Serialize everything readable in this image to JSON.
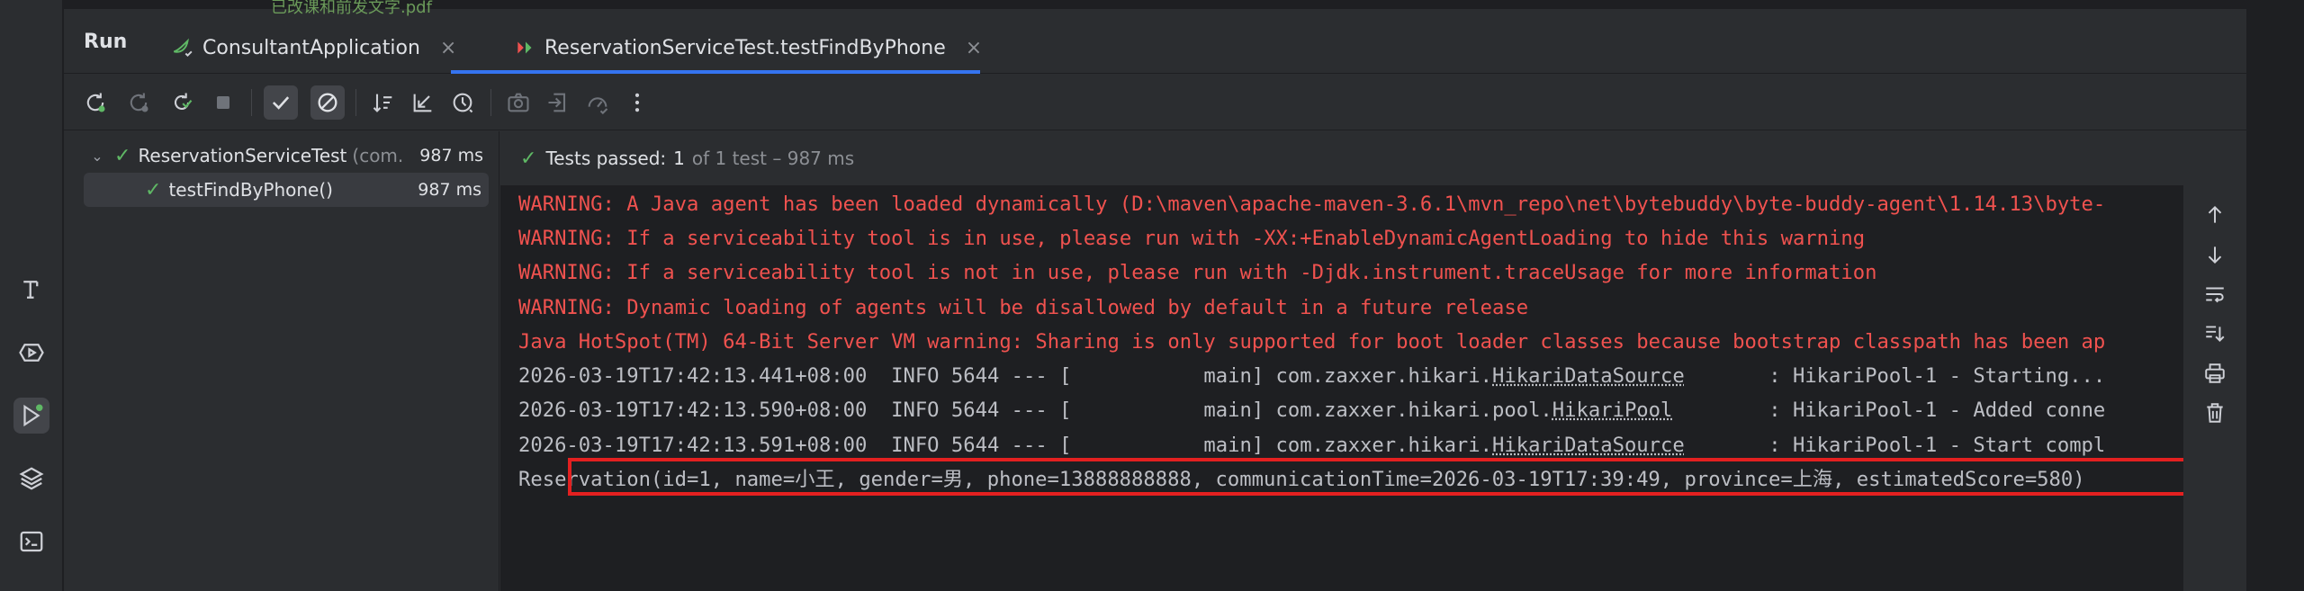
{
  "top_fragment": "已改课和前发文字.pdf",
  "tool_window": {
    "title": "Run"
  },
  "tabs": [
    {
      "label": "ConsultantApplication",
      "icon": "spring-app-icon",
      "close": "×"
    },
    {
      "label": "ReservationServiceTest.testFindByPhone",
      "icon": "test-run-icon",
      "close": "×"
    }
  ],
  "toolbar": {
    "buttons": [
      "rerun-icon",
      "rerun-failed-icon",
      "rerun-auto-icon",
      "stop-icon",
      "show-passed-icon",
      "show-ignored-icon",
      "sort-icon",
      "collapse-icon",
      "history-icon",
      "screenshot-icon",
      "export-icon",
      "coverage-icon",
      "more-icon"
    ]
  },
  "tree": {
    "root": {
      "label": "ReservationServiceTest",
      "package": "(com.",
      "duration": "987 ms"
    },
    "child": {
      "label": "testFindByPhone()",
      "duration": "987 ms"
    }
  },
  "status": {
    "prefix": "Tests passed:",
    "count": "1",
    "suffix": "of 1 test – 987 ms"
  },
  "console": {
    "lines": [
      {
        "type": "warn",
        "text": "WARNING: A Java agent has been loaded dynamically (D:\\maven\\apache-maven-3.6.1\\mvn_repo\\net\\bytebuddy\\byte-buddy-agent\\1.14.13\\byte-"
      },
      {
        "type": "warn",
        "text": "WARNING: If a serviceability tool is in use, please run with -XX:+EnableDynamicAgentLoading to hide this warning"
      },
      {
        "type": "warn",
        "text": "WARNING: If a serviceability tool is not in use, please run with -Djdk.instrument.traceUsage for more information"
      },
      {
        "type": "warn",
        "text": "WARNING: Dynamic loading of agents will be disallowed by default in a future release"
      },
      {
        "type": "warn",
        "text": "Java HotSpot(TM) 64-Bit Server VM warning: Sharing is only supported for boot loader classes because bootstrap classpath has been ap"
      },
      {
        "type": "log",
        "pre": "2026-03-19T17:42:13.441+08:00  INFO 5644 --- [           main] com.zaxxer.hikari.",
        "link": "HikariDataSource",
        "post": "       : HikariPool-1 - Starting..."
      },
      {
        "type": "log",
        "pre": "2026-03-19T17:42:13.590+08:00  INFO 5644 --- [           main] com.zaxxer.hikari.pool.",
        "link": "HikariPool",
        "post": "        : HikariPool-1 - Added conne"
      },
      {
        "type": "log",
        "pre": "2026-03-19T17:42:13.591+08:00  INFO 5644 --- [           main] com.zaxxer.hikari.",
        "link": "HikariDataSource",
        "post": "       : HikariPool-1 - Start compl"
      },
      {
        "type": "out",
        "text": "Reservation(id=1, name=小王, gender=男, phone=13888888888, communicationTime=2026-03-19T17:39:49, province=上海, estimatedScore=580)"
      }
    ]
  },
  "side_actions": [
    "scroll-up-icon",
    "scroll-down-icon",
    "soft-wrap-icon",
    "scroll-to-end-icon",
    "print-icon",
    "clear-icon"
  ],
  "strip_icons": [
    "text-tool-icon",
    "services-icon",
    "run-icon",
    "layers-icon",
    "terminal-icon"
  ],
  "colors": {
    "accent": "#3574f0",
    "pass": "#5fb865",
    "warning": "#f0524f",
    "highlight": "#e32020"
  }
}
